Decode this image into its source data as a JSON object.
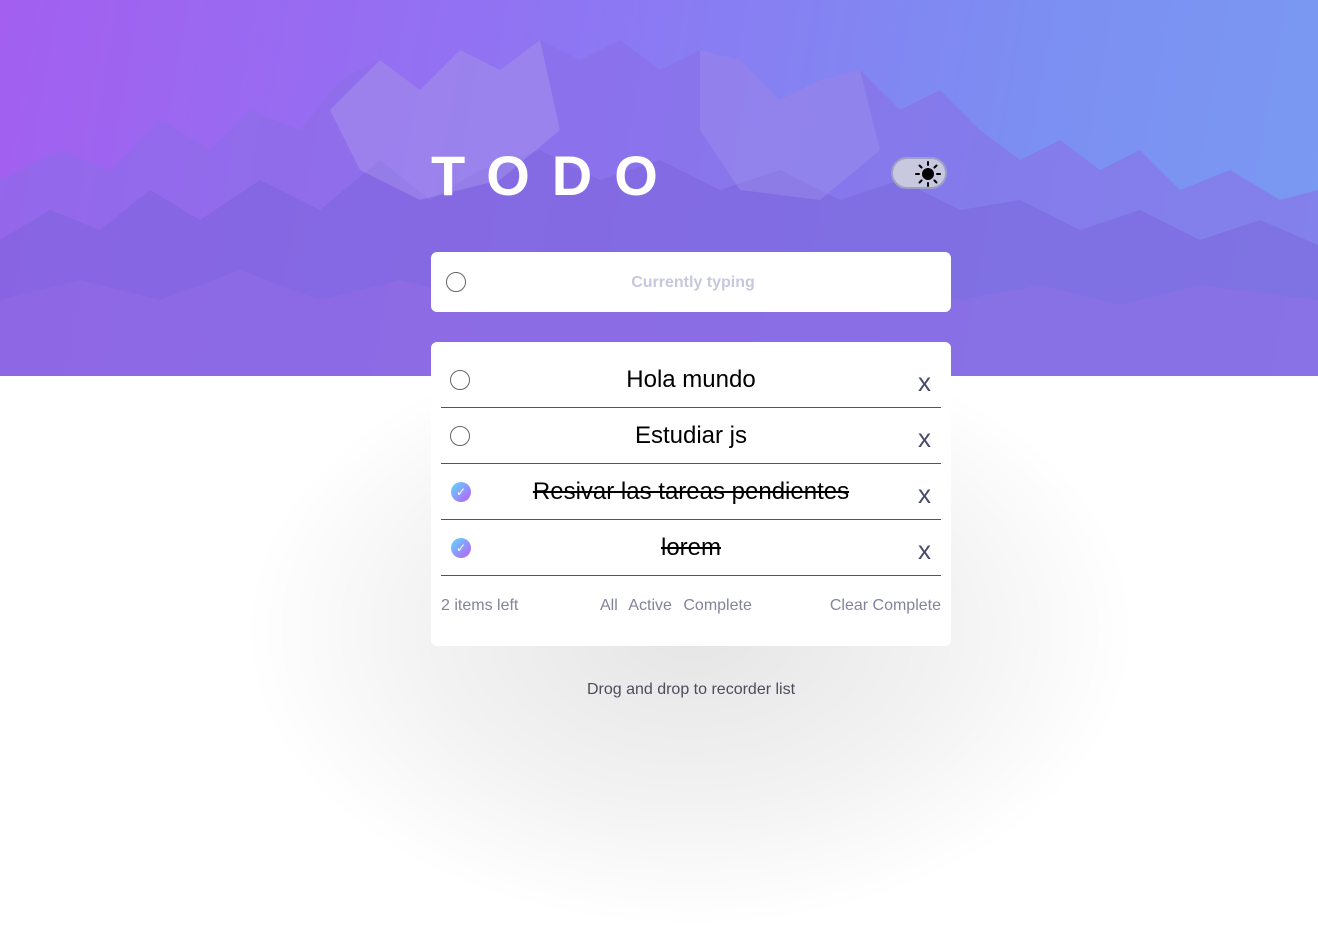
{
  "header": {
    "title": "TODO",
    "theme_toggle_icon": "sun-icon"
  },
  "new_todo": {
    "placeholder": "Currently typing",
    "value": ""
  },
  "todos": [
    {
      "text": "Hola mundo",
      "completed": false,
      "delete_label": "x"
    },
    {
      "text": "Estudiar js",
      "completed": false,
      "delete_label": "x"
    },
    {
      "text": "Resivar las tareas pendientes",
      "completed": true,
      "delete_label": "x"
    },
    {
      "text": "lorem",
      "completed": true,
      "delete_label": "x"
    }
  ],
  "footer": {
    "items_left": "2 items left",
    "filters": [
      "All",
      "Active",
      "Complete"
    ],
    "clear_label": "Clear Complete"
  },
  "hint": "Drog and drop to recorder list",
  "colors": {
    "gradient_start": "#57ddff",
    "gradient_end": "#c058f3",
    "hero_left": "#a35ff0",
    "hero_right": "#7a9af2"
  }
}
